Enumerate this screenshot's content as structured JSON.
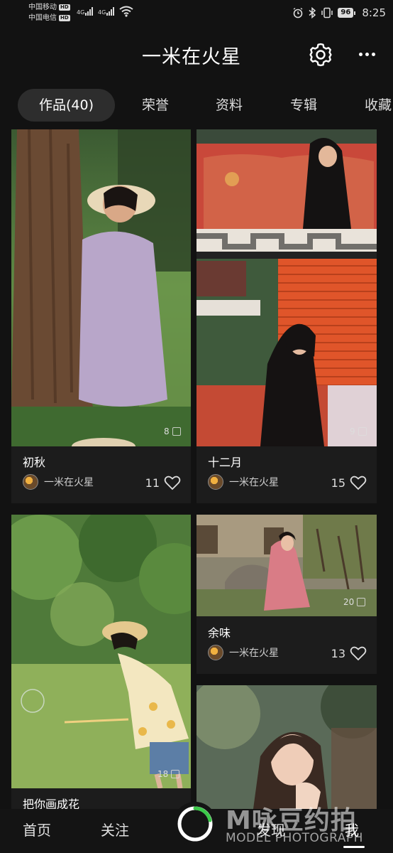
{
  "status_bar": {
    "carrier1": "中国移动",
    "carrier2": "中国电信",
    "hd": "HD",
    "net1": "4G",
    "net2": "4G",
    "battery": "96",
    "time": "8:25"
  },
  "header": {
    "title": "一米在火星"
  },
  "tabs": [
    {
      "label": "作品(40)",
      "active": true
    },
    {
      "label": "荣誉"
    },
    {
      "label": "资料"
    },
    {
      "label": "专辑"
    },
    {
      "label": "收藏"
    }
  ],
  "cards": [
    {
      "title": "初秋",
      "author": "一米在火星",
      "likes": "11",
      "photo_count": "8"
    },
    {
      "title": "十二月",
      "author": "一米在火星",
      "likes": "15",
      "photo_count": "9"
    },
    {
      "title": "余味",
      "author": "一米在火星",
      "likes": "13",
      "photo_count": "20"
    },
    {
      "title": "把你画成花",
      "photo_count": "18"
    }
  ],
  "bottom_nav": {
    "home": "首页",
    "follow": "关注",
    "discover": "发现",
    "me": "我"
  },
  "watermark": {
    "logo": "M咏豆约拍",
    "sub": "MODEL PHOTOGRAPH"
  },
  "colors": {
    "background": "#121212",
    "card": "#1c1c1c",
    "accent_green": "#3cc84a"
  }
}
